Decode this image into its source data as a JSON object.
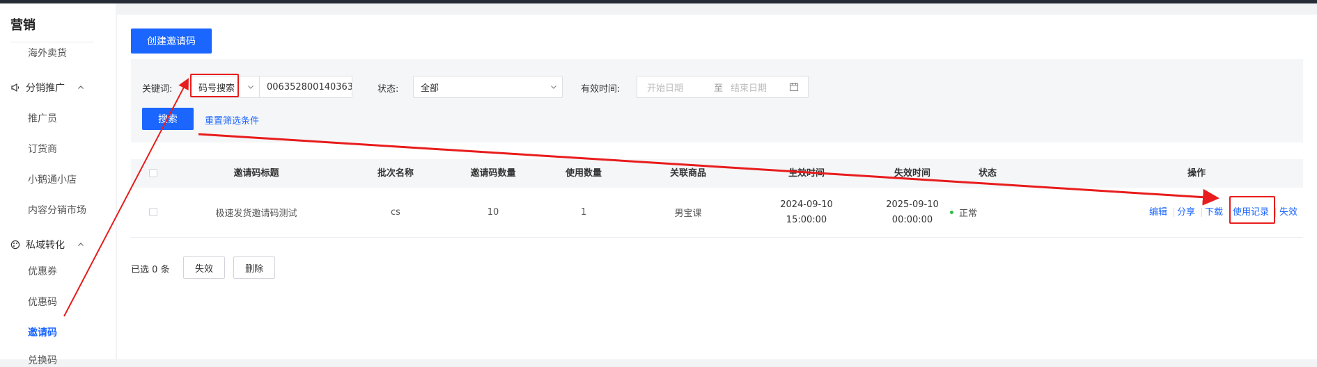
{
  "sidebar": {
    "title": "营销",
    "items": {
      "overseas": "海外卖货",
      "promoter": "推广员",
      "distributor": "订货商",
      "xiaoetong_shop": "小鹅通小店",
      "content_market": "内容分销市场",
      "coupon": "优惠券",
      "coupon_code": "优惠码",
      "invite_code": "邀请码",
      "redeem_code": "兑换码"
    },
    "groups": {
      "distribution": "分销推广",
      "private_domain": "私域转化"
    }
  },
  "toolbar": {
    "create_label": "创建邀请码"
  },
  "filters": {
    "keyword_label": "关键词:",
    "search_type": "码号搜索",
    "keyword_value": "006352800140363",
    "status_label": "状态:",
    "status_value": "全部",
    "valid_time_label": "有效时间:",
    "start_placeholder": "开始日期",
    "range_sep": "至",
    "end_placeholder": "结束日期",
    "search_label": "搜索",
    "reset_label": "重置筛选条件"
  },
  "table": {
    "headers": {
      "title": "邀请码标题",
      "batch": "批次名称",
      "count": "邀请码数量",
      "used": "使用数量",
      "product": "关联商品",
      "start": "生效时间",
      "end": "失效时间",
      "status": "状态",
      "actions": "操作"
    },
    "rows": [
      {
        "title": "极速发货邀请码测试",
        "batch": "cs",
        "count": "10",
        "used": "1",
        "product": "男宝课",
        "start_date": "2024-09-10",
        "start_time": "15:00:00",
        "end_date": "2025-09-10",
        "end_time": "00:00:00",
        "status": "正常",
        "actions": {
          "edit": "编辑",
          "share": "分享",
          "download": "下载",
          "usage_record": "使用记录",
          "invalidate": "失效"
        }
      }
    ]
  },
  "footer": {
    "selected_prefix": "已选",
    "selected_count": "0",
    "selected_suffix": "条",
    "invalidate_label": "失效",
    "delete_label": "删除"
  },
  "colors": {
    "accent": "#1a66ff",
    "annotation": "#e81c1c",
    "status_ok": "#2db84d"
  }
}
